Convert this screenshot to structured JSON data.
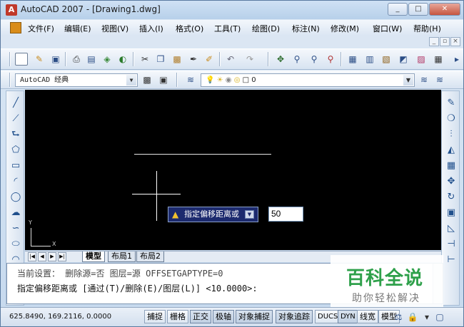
{
  "window": {
    "title": "AutoCAD 2007 - [Drawing1.dwg]",
    "minimize": "_",
    "maximize": "□",
    "close": "✕"
  },
  "menu": [
    "文件(F)",
    "编辑(E)",
    "视图(V)",
    "插入(I)",
    "格式(O)",
    "工具(T)",
    "绘图(D)",
    "标注(N)",
    "修改(M)",
    "窗口(W)",
    "帮助(H)"
  ],
  "mdi": {
    "minimize": "_",
    "restore": "▫",
    "close": "×"
  },
  "workspace": {
    "value": "AutoCAD 经典"
  },
  "layer": {
    "value": "0"
  },
  "canvas": {
    "tooltip_prompt": "指定偏移距离或",
    "input_value": "50",
    "ucs_x": "X",
    "ucs_y": "Y"
  },
  "layout_tabs": [
    "模型",
    "布局1",
    "布局2"
  ],
  "command": {
    "history": "当前设置：  删除源=否  图层=源  OFFSETGAPTYPE=0",
    "prompt": "指定偏移距离或 [通过(T)/删除(E)/图层(L)] <10.0000>:"
  },
  "status": {
    "coords": "625.8490,  169.2116, 0.0000",
    "buttons": [
      "捕捉",
      "栅格",
      "正交",
      "极轴",
      "对象捕捉",
      "对象追踪",
      "DUCS",
      "DYN",
      "线宽",
      "模型"
    ]
  },
  "watermark": {
    "title": "百科全说",
    "subtitle": "助你轻松解决"
  },
  "colors": {
    "canvas": "#000000",
    "tooltip": "#1c2a6e",
    "watermark": "#2ea04a"
  }
}
